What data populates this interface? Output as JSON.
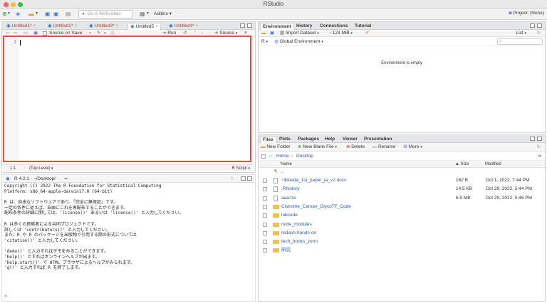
{
  "window": {
    "title": "RStudio"
  },
  "toolbar": {
    "goto_placeholder": "Go to file/function",
    "addins_label": "Addins",
    "project_label": "Project: (None)"
  },
  "source": {
    "tabs": [
      {
        "label": "Untitled1*",
        "unsaved": true
      },
      {
        "label": "Untitled2*",
        "unsaved": true
      },
      {
        "label": "Untitled3*",
        "unsaved": true
      },
      {
        "label": "Untitled5",
        "unsaved": false
      },
      {
        "label": "Untitled4*",
        "unsaved": true
      }
    ],
    "source_on_save": "Source on Save",
    "run_label": "Run",
    "source_label": "Source",
    "line_number": "1",
    "status_position": "1:1",
    "status_scope": "(Top Level)",
    "status_type": "R Script"
  },
  "console": {
    "header": "R 4.2.1 · ~/Desktop/",
    "lines": [
      "Copyright (C) 2022 The R Foundation for Statistical Computing",
      "Platform: x86_64-apple-darwin17.0 (64-bit)",
      "",
      "R は、自由なソフトウェアであり、「完全に無保証」です。",
      "一定の条件に従えば、自由にこれを再配布することができます。",
      "配布条件の詳細に関しては、'license()' あるいは 'licence()' と入力してください。",
      "",
      "R は多くの貢献者による共同プロジェクトです。",
      "詳しくは 'contributors()' と入力してください。",
      "また、R や R のパッケージを出版物で引用する際の形式については",
      "'citation()' と入力してください。",
      "",
      "'demo()' と入力すればデモをみることができます。",
      "'help()' とすればオンラインヘルプが出ます。",
      "'help.start()' で HTML ブラウザによるヘルプがみられます。",
      "'q()' と入力すれば R を終了します。"
    ],
    "prompt": ">"
  },
  "environment": {
    "tabs": [
      "Environment",
      "History",
      "Connections",
      "Tutorial"
    ],
    "import_label": "Import Dataset",
    "memory_label": "124 MiB",
    "list_label": "List",
    "lang_label": "R",
    "scope_label": "Global Environment",
    "empty_message": "Environment is empty"
  },
  "files": {
    "tabs": [
      "Files",
      "Plots",
      "Packages",
      "Help",
      "Viewer",
      "Presentation"
    ],
    "new_folder": "New Folder",
    "new_blank": "New Blank File",
    "delete": "Delete",
    "rename": "Rename",
    "more": "More",
    "crumb_home": "Home",
    "crumb_sep": "›",
    "crumb_current": "Desktop",
    "col_name": "Name",
    "col_size": "Size",
    "col_modified": "Modified",
    "up_label": "..",
    "rows": [
      {
        "name": "~$reeda_1st_paper_ja_v2.docx",
        "size": "162 B",
        "modified": "Oct 1, 2022, 7:44 PM",
        "kind": "file"
      },
      {
        "name": ".Rhistory",
        "size": "14.5 KB",
        "modified": "Oct 29, 2022, 5:44 PM",
        "kind": "file"
      },
      {
        "name": "aaa.tsv",
        "size": "6.9 MB",
        "modified": "Oct 29, 2022, 5:46 PM",
        "kind": "file"
      },
      {
        "name": "Cistrome_Cancer_GlycoTF_Code",
        "size": "",
        "modified": "",
        "kind": "folder"
      },
      {
        "name": "labcode",
        "size": "",
        "modified": "",
        "kind": "folder"
      },
      {
        "name": "node_modules",
        "size": "",
        "modified": "",
        "kind": "folder"
      },
      {
        "name": "redash-hands-on",
        "size": "",
        "modified": "",
        "kind": "folder"
      },
      {
        "name": "tech_books_zenn",
        "size": "",
        "modified": "",
        "kind": "folder"
      },
      {
        "name": "研究",
        "size": "",
        "modified": "",
        "kind": "folder"
      }
    ]
  }
}
